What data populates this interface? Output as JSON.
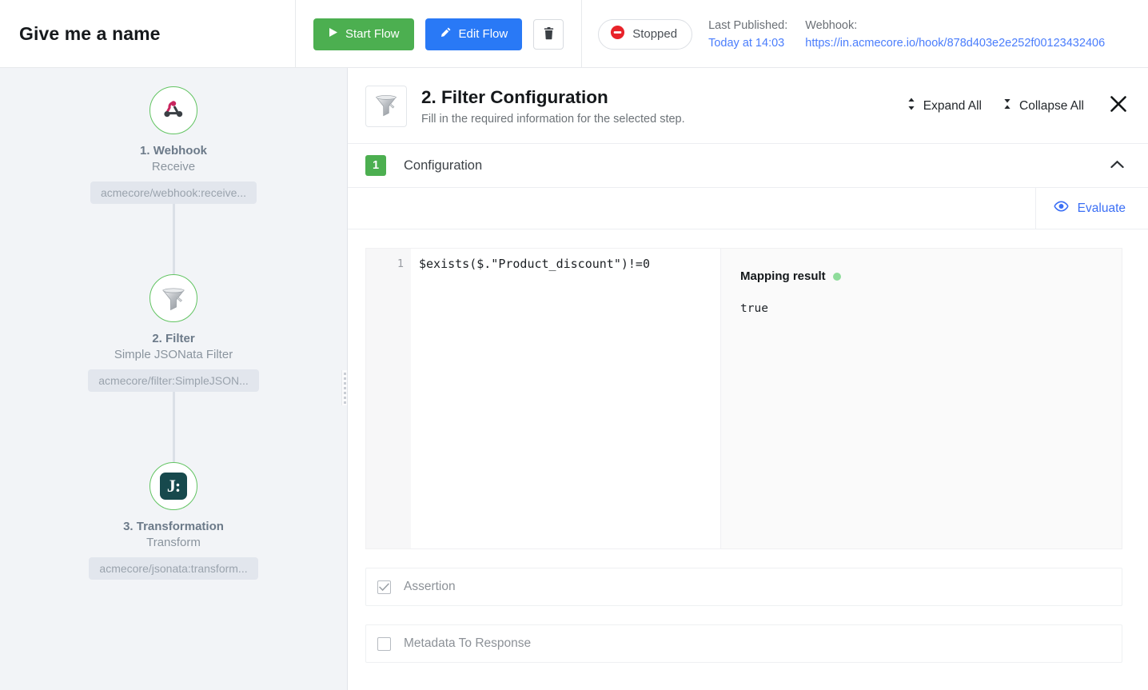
{
  "header": {
    "app_title": "Give me a name",
    "buttons": {
      "start_flow": "Start Flow",
      "edit_flow": "Edit Flow",
      "delete_icon": "trash-icon"
    },
    "status": {
      "label": "Stopped",
      "icon": "stop-circle-icon",
      "color": "#e8232a"
    },
    "meta": [
      {
        "label": "Last Published:",
        "value": "Today at 14:03"
      },
      {
        "label": "Webhook:",
        "value": "https://in.acmecore.io/hook/878d403e2e252f00123432406"
      }
    ]
  },
  "flow": {
    "nodes": [
      {
        "index": "1.",
        "title": "1. Webhook",
        "subtitle": "Receive",
        "chip": "acmecore/webhook:receive...",
        "icon": "webhook-icon",
        "ring_color": "#62c462"
      },
      {
        "index": "2.",
        "title": "2. Filter",
        "subtitle": "Simple JSONata Filter",
        "chip": "acmecore/filter:SimpleJSON...",
        "icon": "funnel-icon",
        "ring_color": "#62c462"
      },
      {
        "index": "3.",
        "title": "3. Transformation",
        "subtitle": "Transform",
        "chip": "acmecore/jsonata:transform...",
        "icon": "jsonata-icon",
        "ring_color": "#62c462"
      }
    ],
    "resize_handle": "panel-resize-handle"
  },
  "config": {
    "icon": "funnel-icon",
    "title": "2. Filter Configuration",
    "subtitle": "Fill in the required information for the selected step.",
    "expand_all": "Expand All",
    "collapse_all": "Collapse All",
    "close_icon": "close-icon",
    "section": {
      "badge": "1",
      "title": "Configuration",
      "chevron": "chevron-up-icon",
      "expanded": true
    },
    "evaluate": {
      "label": "Evaluate",
      "icon": "eye-icon",
      "color": "#3b6ff5"
    },
    "editor": {
      "line_numbers": [
        "1"
      ],
      "lines": [
        "$exists($.\"Product_discount\")!=0"
      ]
    },
    "result": {
      "title": "Mapping result",
      "status_color": "#8fdc9b",
      "value": "true"
    },
    "checkboxes": [
      {
        "label": "Assertion",
        "checked": true
      },
      {
        "label": "Metadata To Response",
        "checked": false
      }
    ]
  }
}
